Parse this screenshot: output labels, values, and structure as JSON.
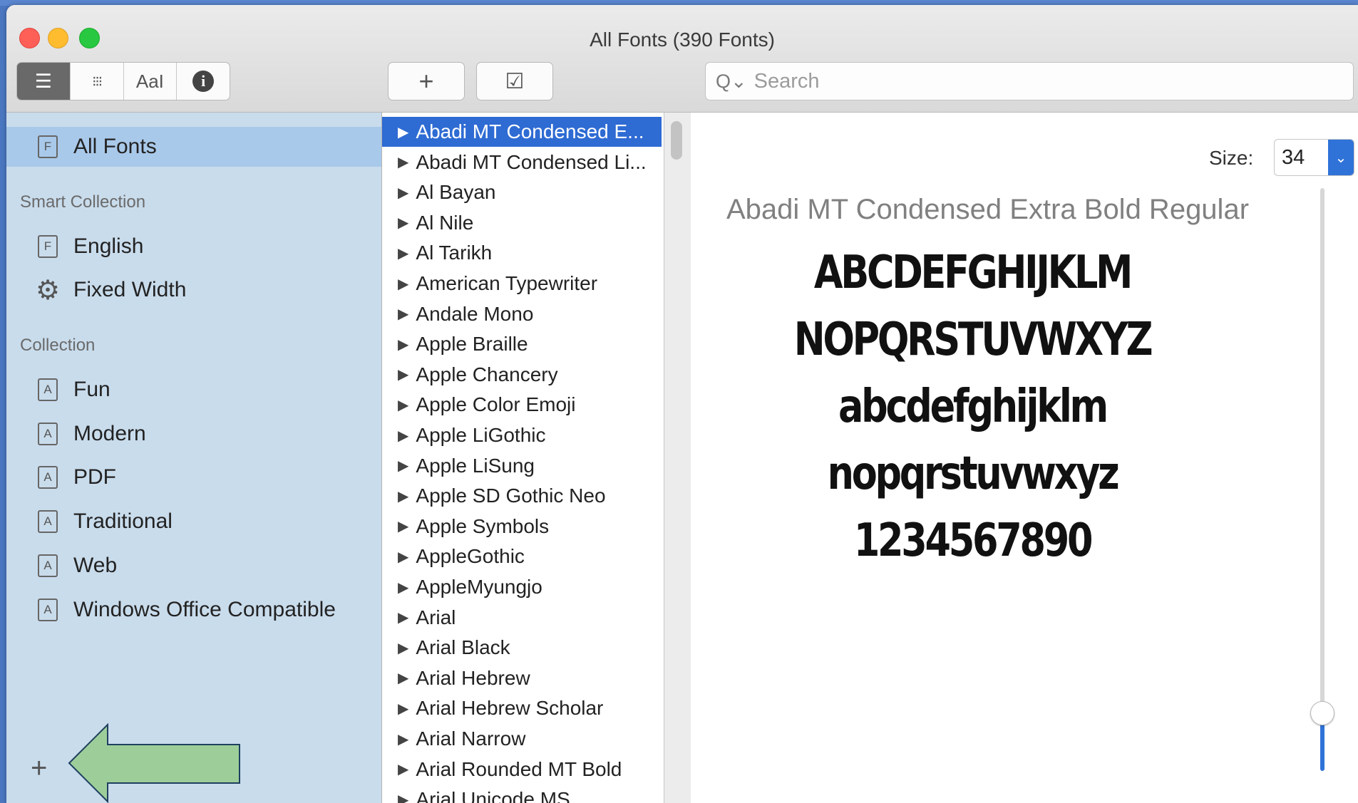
{
  "window": {
    "title": "All Fonts (390 Fonts)"
  },
  "toolbar": {
    "view_modes": [
      {
        "name": "list-view",
        "glyph": "☰"
      },
      {
        "name": "grid-view",
        "glyph": "⁝⁝⁝"
      },
      {
        "name": "sample-view",
        "glyph": "AaI"
      },
      {
        "name": "info-view",
        "glyph": "ℹ"
      }
    ],
    "add_glyph": "+",
    "check_glyph": "☑",
    "search_placeholder": "Search",
    "search_icon": "Q⌄"
  },
  "sidebar": {
    "all_fonts": "All Fonts",
    "smart_collection_header": "Smart Collection",
    "smart_collections": [
      {
        "label": "English",
        "icon": "F"
      },
      {
        "label": "Fixed Width",
        "icon": "gear"
      }
    ],
    "collection_header": "Collection",
    "collections": [
      "Fun",
      "Modern",
      "PDF",
      "Traditional",
      "Web",
      "Windows Office Compatible"
    ],
    "add_glyph": "+"
  },
  "font_list": [
    "Abadi MT Condensed E...",
    "Abadi MT Condensed Li...",
    "Al Bayan",
    "Al Nile",
    "Al Tarikh",
    "American Typewriter",
    "Andale Mono",
    "Apple Braille",
    "Apple Chancery",
    "Apple Color Emoji",
    "Apple LiGothic",
    "Apple LiSung",
    "Apple SD Gothic Neo",
    "Apple Symbols",
    "AppleGothic",
    "AppleMyungjo",
    "Arial",
    "Arial Black",
    "Arial Hebrew",
    "Arial Hebrew Scholar",
    "Arial Narrow",
    "Arial Rounded MT Bold",
    "Arial Unicode MS"
  ],
  "preview": {
    "size_label": "Size:",
    "size_value": "34",
    "font_name": "Abadi MT Condensed Extra Bold Regular",
    "lines": [
      "ABCDEFGHIJKLM",
      "NOPQRSTUVWXYZ",
      "abcdefghijklm",
      "nopqrstuvwxyz",
      "1234567890"
    ],
    "size_slider_fraction": 0.1
  },
  "colors": {
    "selection": "#2e6bd3",
    "sidebar_bg": "#c9dcec",
    "annotation_arrow": "#9dce9a"
  }
}
